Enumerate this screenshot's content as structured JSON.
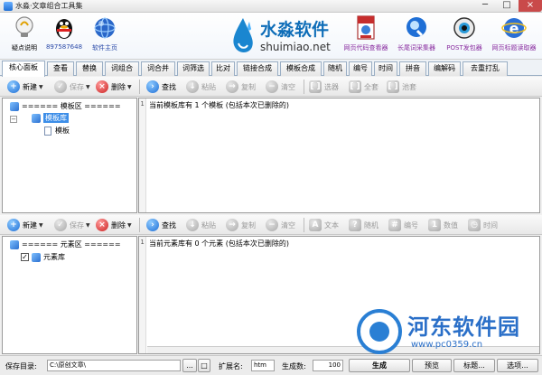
{
  "window": {
    "title": "水淼·文章组合工具集",
    "controls": [
      "─",
      "□",
      "×"
    ]
  },
  "header": {
    "left_buttons": [
      {
        "label": "疑点说明",
        "icon": "help-lightbulb-icon"
      },
      {
        "label": "897587648",
        "icon": "qq-penguin-icon"
      },
      {
        "label": "软件主页",
        "icon": "homepage-globe-icon"
      }
    ],
    "logo": {
      "cn": "水淼软件",
      "en": "shuimiao.net"
    },
    "right_buttons": [
      {
        "label": "网页代码查看器",
        "icon": "html-file-icon"
      },
      {
        "label": "长尾词采集器",
        "icon": "search-globe-icon"
      },
      {
        "label": "POST发包器",
        "icon": "eye-icon"
      },
      {
        "label": "网页标题读取器",
        "icon": "ie-browser-icon"
      }
    ]
  },
  "tabs": [
    "核心面板",
    "查看",
    "替换",
    "词组合",
    "词合并",
    "词筛选",
    "比对",
    "链接合成",
    "模板合成",
    "随机",
    "编号",
    "时间",
    "拼音",
    "编解码",
    "去重打乱"
  ],
  "active_tab": 0,
  "toolbar_top": {
    "new": "新建",
    "save": "保存",
    "delete": "删除",
    "find": "查找",
    "paste": "粘贴",
    "copy": "复制",
    "clear": "清空",
    "select": "选器",
    "select_all": "全套",
    "pool": "池套"
  },
  "template_tree": {
    "header": "====== 模板区 ======",
    "folder": "模板库",
    "item": "模板"
  },
  "template_editor": {
    "line_no": "1",
    "text": "当前模板库有 1 个模板 (包括本次已删除的)"
  },
  "toolbar_bottom": {
    "new": "新建",
    "save": "保存",
    "delete": "删除",
    "find": "查找",
    "paste": "粘贴",
    "copy": "复制",
    "clear": "清空",
    "text": "文本",
    "random": "随机",
    "number": "编号",
    "value": "数值",
    "time": "时间"
  },
  "element_tree": {
    "header": "====== 元素区 ======",
    "folder": "元素库",
    "checked": "✓"
  },
  "element_editor": {
    "line_no": "1",
    "text": "当前元素库有 0 个元素 (包括本次已删除的)"
  },
  "statusbar": {
    "save_dir_label": "保存目录:",
    "save_dir_value": "C:\\原创文章\\",
    "browse": "...",
    "browse_small": "□",
    "ext_label": "扩展名:",
    "ext_value": "htm",
    "count_label": "生成数:",
    "count_value": "100",
    "generate": "生成",
    "preview": "预览",
    "title_btn": "标题...",
    "options": "选项..."
  },
  "watermark": {
    "text": "河东软件园",
    "url": "www.pc0359.cn"
  }
}
